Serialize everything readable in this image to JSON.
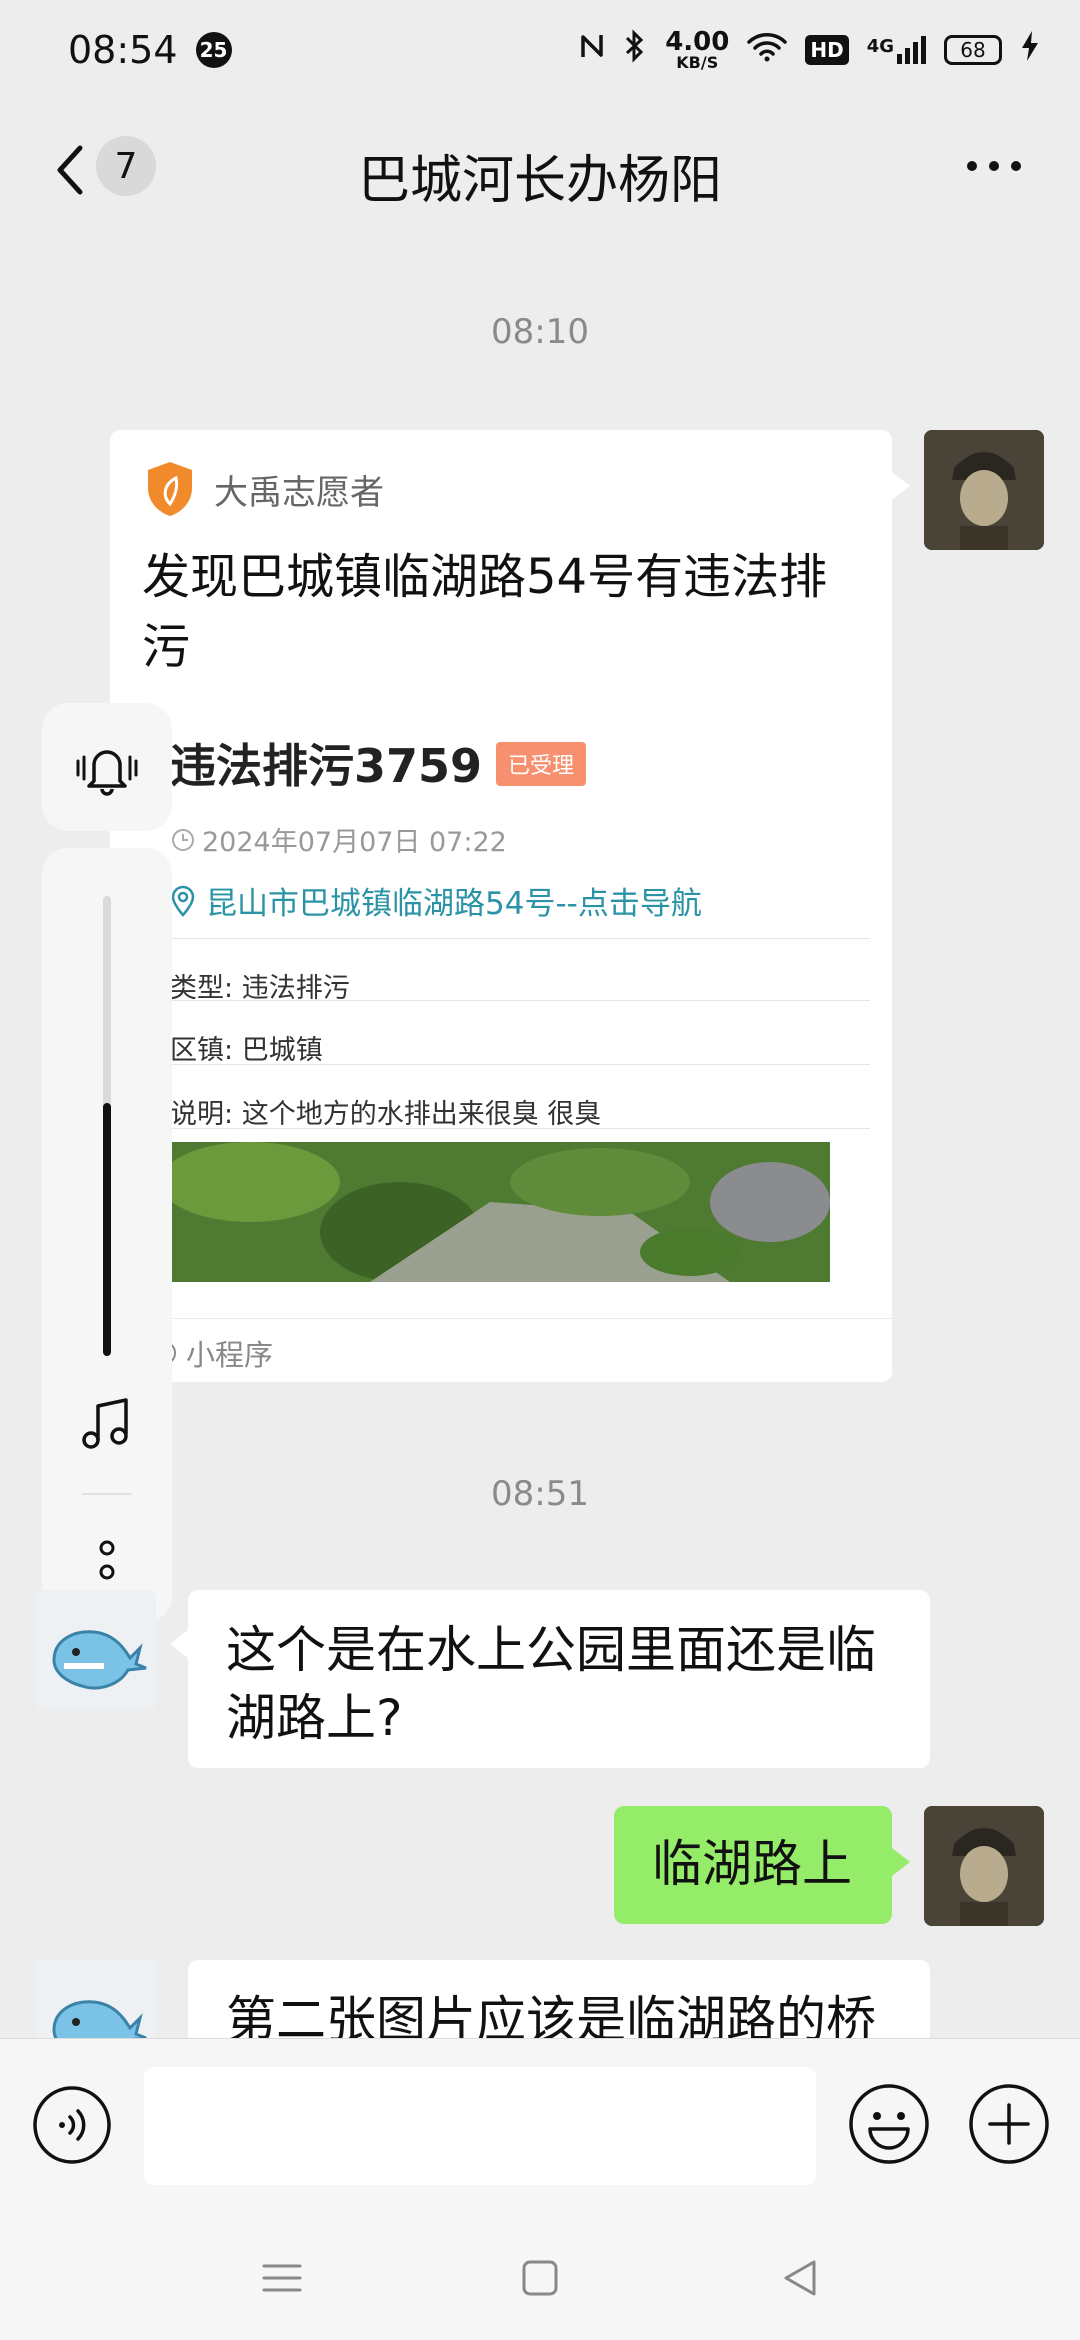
{
  "status_bar": {
    "time": "08:54",
    "notification_count": "25",
    "net_speed_value": "4.00",
    "net_speed_unit": "KB/S",
    "hd_label": "HD",
    "network_label": "4G",
    "battery_level": "68"
  },
  "header": {
    "unread_count": "7",
    "title": "巴城河长办杨阳"
  },
  "timestamps": [
    "08:10",
    "08:51"
  ],
  "mini_program_card": {
    "app_name": "大禹志愿者",
    "title": "发现巴城镇临湖路54号有违法排污",
    "case_title": "违法排污3759",
    "status_tag": "已受理",
    "datetime": "2024年07月07日 07:22",
    "address": "昆山市巴城镇临湖路54号--点击导航",
    "fields": [
      {
        "label": "类型:",
        "value": "违法排污"
      },
      {
        "label": "区镇:",
        "value": "巴城镇"
      },
      {
        "label": "说明:",
        "value": "这个地方的水排出来很臭 很臭"
      }
    ],
    "footer_label": "小程序"
  },
  "messages": [
    {
      "side": "left",
      "text": "这个是在水上公园里面还是临湖路上?"
    },
    {
      "side": "right",
      "text": "临湖路上"
    },
    {
      "side": "left",
      "text": "第二张图片应该是临湖路的桥"
    }
  ],
  "floating_controls": {
    "volume_level": 0.55
  },
  "colors": {
    "chat_background": "#ededed",
    "sent_bubble": "#95ec69",
    "status_tag": "#f6906f",
    "link_teal": "#2a94a6",
    "shield_orange": "#f08a2b"
  },
  "icons": [
    "back-chevron-icon",
    "more-dots-icon",
    "shield-leaf-icon",
    "clock-icon",
    "location-pin-icon",
    "mini-program-icon",
    "bell-icon",
    "music-note-icon",
    "vertical-dots-icon",
    "voice-icon",
    "emoji-icon",
    "plus-icon",
    "menu-icon",
    "home-square-icon",
    "back-triangle-icon"
  ]
}
